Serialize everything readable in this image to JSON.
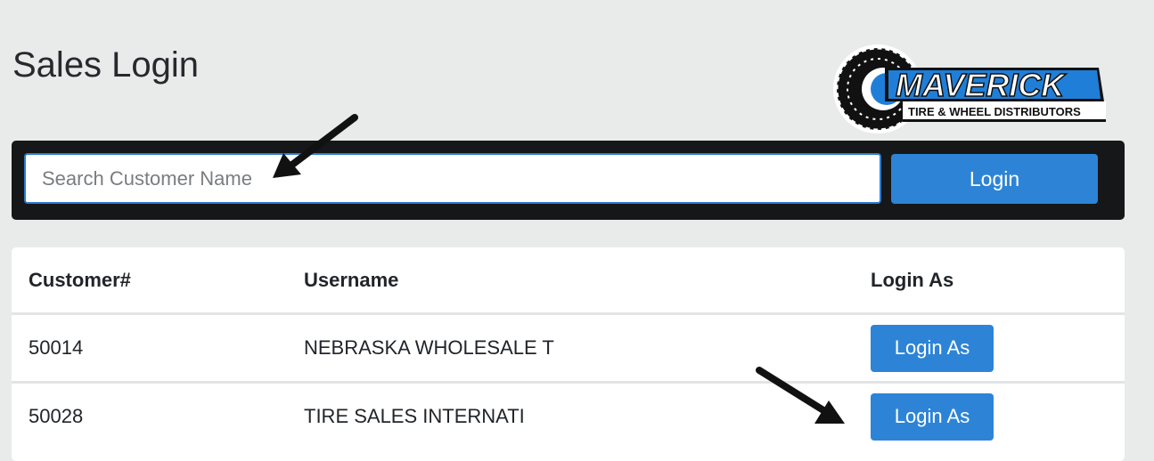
{
  "page": {
    "title": "Sales Login"
  },
  "logo": {
    "brand": "MAVERICK",
    "tagline": "TIRE & WHEEL DISTRIBUTORS"
  },
  "search": {
    "placeholder": "Search Customer Name",
    "value": "",
    "login_label": "Login"
  },
  "table": {
    "headers": [
      "Customer#",
      "Username",
      "Login As"
    ],
    "rows": [
      {
        "customer": "50014",
        "username": "NEBRASKA WHOLESALE T",
        "action": "Login As"
      },
      {
        "customer": "50028",
        "username": "TIRE SALES INTERNATI",
        "action": "Login As"
      }
    ]
  },
  "colors": {
    "accent": "#2d84d6",
    "bar": "#161718",
    "background": "#e9eaea",
    "brand_blue": "#1f7fd8"
  },
  "annotations": {
    "icon": "arrow-icon",
    "count": 2
  }
}
